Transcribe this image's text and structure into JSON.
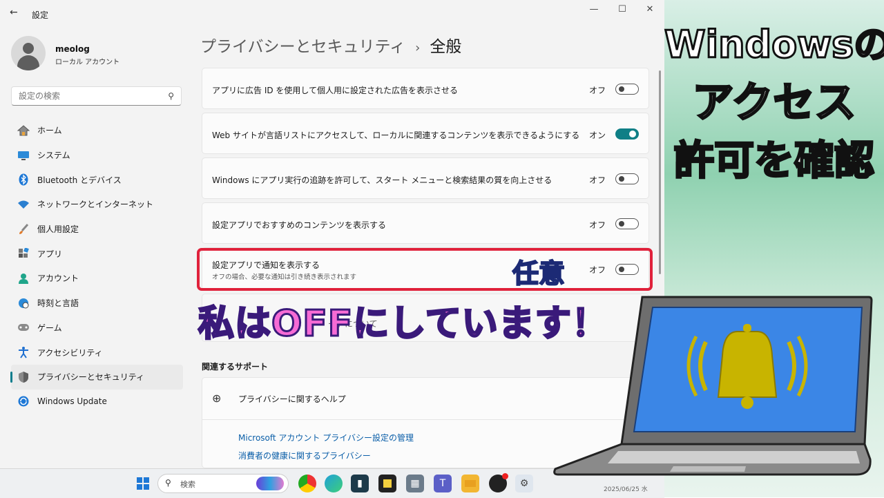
{
  "window": {
    "back_icon": "back-arrow-icon",
    "title": "設定",
    "controls": {
      "minimize": "—",
      "maximize": "☐",
      "close": "✕"
    }
  },
  "profile": {
    "name": "meolog",
    "type": "ローカル アカウント"
  },
  "search": {
    "placeholder": "設定の検索"
  },
  "nav": {
    "items": [
      {
        "label": "ホーム",
        "icon": "home-icon"
      },
      {
        "label": "システム",
        "icon": "system-icon"
      },
      {
        "label": "Bluetooth とデバイス",
        "icon": "bluetooth-icon"
      },
      {
        "label": "ネットワークとインターネット",
        "icon": "wifi-icon"
      },
      {
        "label": "個人用設定",
        "icon": "brush-icon"
      },
      {
        "label": "アプリ",
        "icon": "apps-icon"
      },
      {
        "label": "アカウント",
        "icon": "account-icon"
      },
      {
        "label": "時刻と言語",
        "icon": "globe-clock-icon"
      },
      {
        "label": "ゲーム",
        "icon": "gamepad-icon"
      },
      {
        "label": "アクセシビリティ",
        "icon": "accessibility-icon"
      },
      {
        "label": "プライバシーとセキュリティ",
        "icon": "shield-icon",
        "active": true
      },
      {
        "label": "Windows Update",
        "icon": "update-icon"
      }
    ]
  },
  "breadcrumb": {
    "parent": "プライバシーとセキュリティ",
    "separator": "›",
    "current": "全般"
  },
  "settings": [
    {
      "label": "アプリに広告 ID を使用して個人用に設定された広告を表示させる",
      "state": "オフ",
      "on": false
    },
    {
      "label": "Web サイトが言語リストにアクセスして、ローカルに関連するコンテンツを表示できるようにする",
      "state": "オン",
      "on": true
    },
    {
      "label": "Windows にアプリ実行の追跡を許可して、スタート メニューと検索結果の質を向上させる",
      "state": "オフ",
      "on": false
    },
    {
      "label": "設定アプリでおすすめのコンテンツを表示する",
      "state": "オフ",
      "on": false
    },
    {
      "label": "設定アプリで通知を表示する",
      "sub": "オフの場合、必要な通知は引き続き表示されます",
      "state": "オフ",
      "on": false
    }
  ],
  "hidden_row_text": "ードについて",
  "related": {
    "title": "関連するサポート",
    "help_title": "プライバシーに関するヘルプ",
    "links": [
      "Microsoft アカウント プライバシー設定の管理",
      "消費者の健康に関するプライバシー"
    ]
  },
  "overlay": {
    "optional": "任意",
    "note": "私はOFFにしています！",
    "title_lines": [
      "Windowsの",
      "アクセス",
      "許可を確認"
    ]
  },
  "taskbar": {
    "search_label": "検索",
    "clock": "2025/06/25 水"
  },
  "colors": {
    "accent": "#0f7f86",
    "highlight": "#e0213b",
    "bell": "#c8b400",
    "screen": "#3b86e6"
  }
}
